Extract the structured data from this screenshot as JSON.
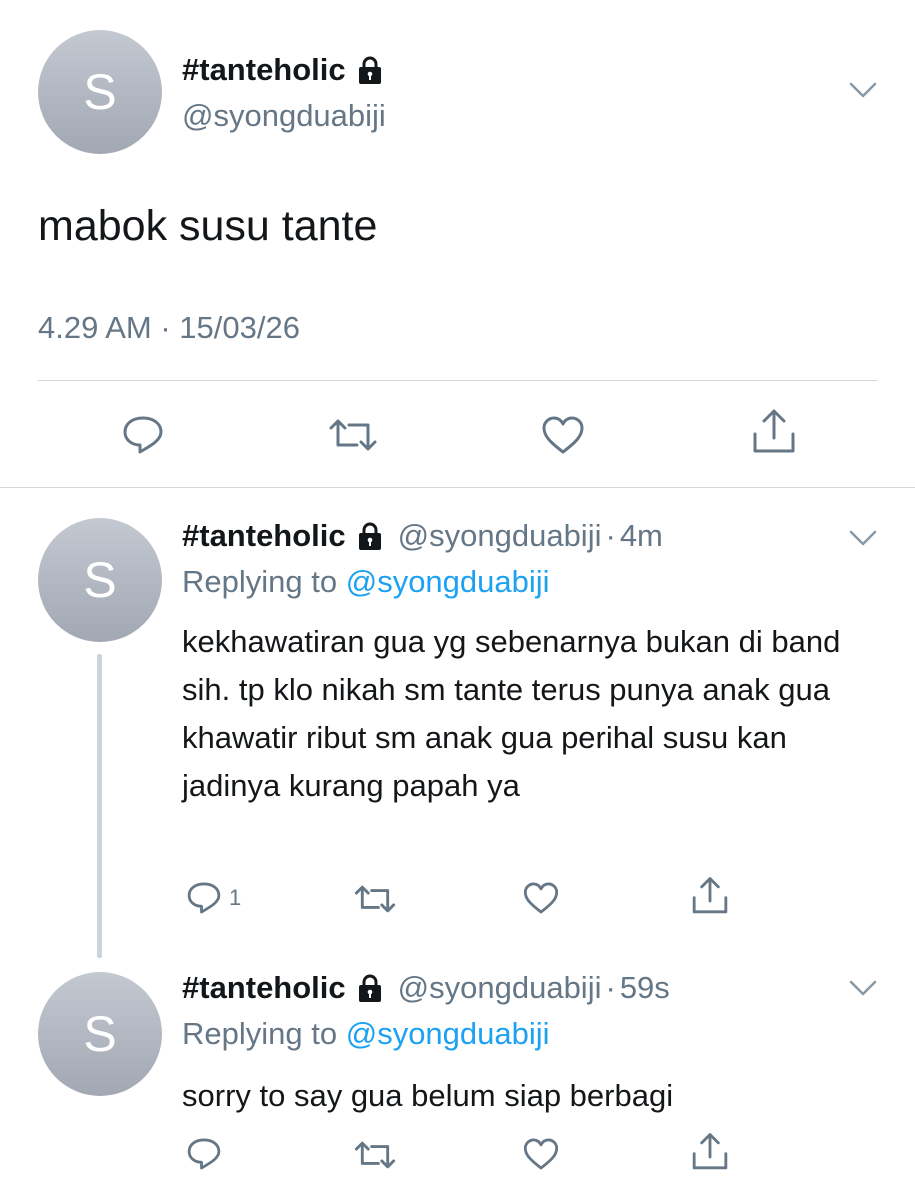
{
  "main_tweet": {
    "avatar_letter": "S",
    "display_name": "#tanteholic",
    "handle": "@syongduabiji",
    "text": "mabok susu tante",
    "timestamp": "4.29 AM · 15/03/26",
    "icons": [
      "lock-icon",
      "chevron-down-icon",
      "reply-icon",
      "retweet-icon",
      "like-icon",
      "share-icon"
    ]
  },
  "replies": [
    {
      "avatar_letter": "S",
      "display_name": "#tanteholic",
      "handle": "@syongduabiji",
      "separator": "·",
      "time": "4m",
      "replying_prefix": "Replying to",
      "replying_handle": "@syongduabiji",
      "text": "kekhawatiran gua yg sebenarnya bukan di band sih. tp klo nikah sm tante terus punya anak gua khawatir ribut sm anak gua perihal susu kan jadinya kurang papah ya",
      "reply_count": "1"
    },
    {
      "avatar_letter": "S",
      "display_name": "#tanteholic",
      "handle": "@syongduabiji",
      "separator": "·",
      "time": "59s",
      "replying_prefix": "Replying to",
      "replying_handle": "@syongduabiji",
      "text": "sorry to say gua belum siap berbagi",
      "reply_count": ""
    }
  ],
  "colors": {
    "text": "#14171a",
    "secondary": "#657786",
    "link": "#1da1f2",
    "divider": "#cfd6dc"
  }
}
